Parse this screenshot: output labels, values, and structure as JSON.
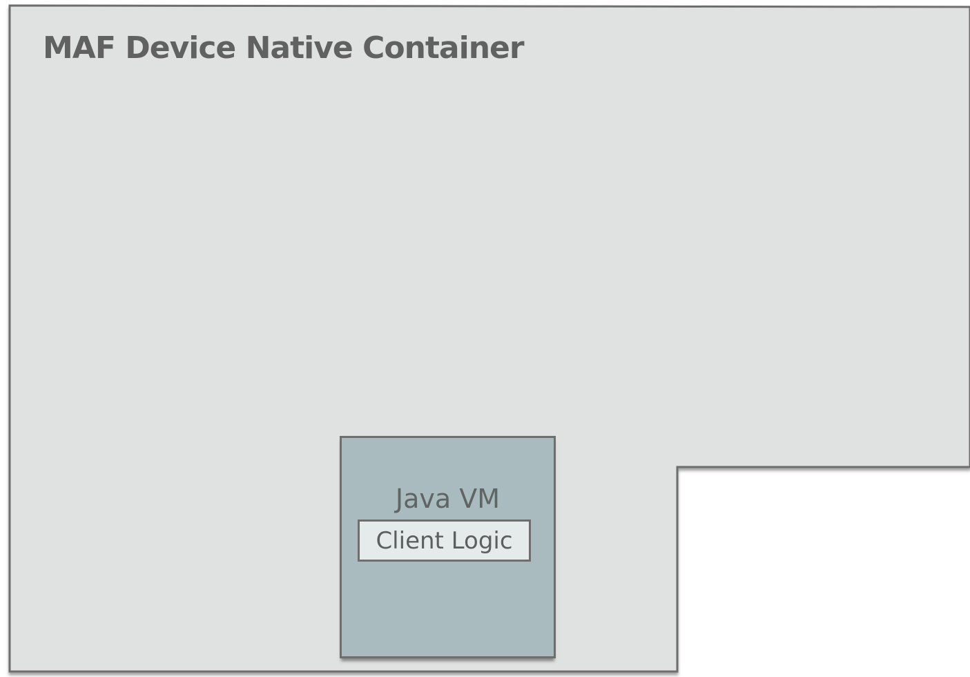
{
  "diagram": {
    "container": {
      "title": "MAF Device Native Container",
      "fill": "#e0e2e1",
      "stroke": "#6e6e6e"
    },
    "java_vm": {
      "label": "Java VM",
      "fill": "#aabbbf",
      "client_logic": {
        "label": "Client Logic",
        "fill": "#e5ebeb"
      }
    }
  }
}
